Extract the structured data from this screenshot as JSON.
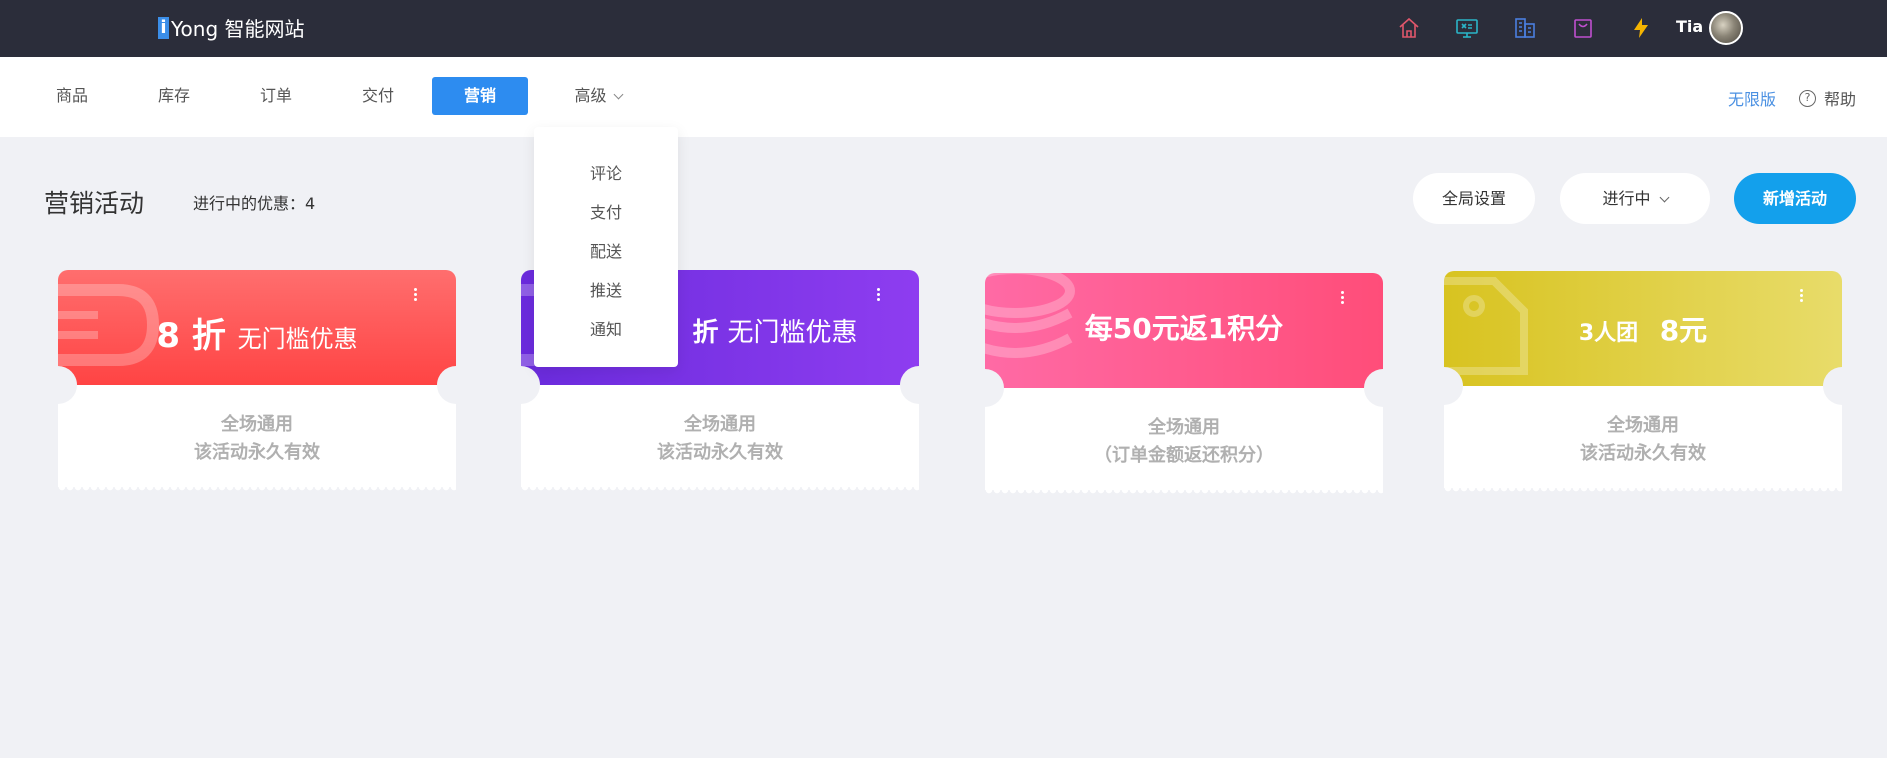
{
  "header": {
    "logo_mark": "i",
    "logo_text": "Yong 智能网站",
    "icons": [
      "home-icon",
      "monitor-icon",
      "building-icon",
      "bag-icon",
      "lightning-icon"
    ],
    "icon_colors": [
      "#e0566b",
      "#2bb5c8",
      "#4a7fe0",
      "#c04fd0",
      "#f5b400"
    ],
    "user_name": "Tia"
  },
  "nav": {
    "items": [
      "商品",
      "库存",
      "订单",
      "交付",
      "营销",
      "高级"
    ],
    "active": "营销",
    "unlimited": "无限版",
    "help": "帮助"
  },
  "dropdown": {
    "items": [
      "评论",
      "支付",
      "配送",
      "推送",
      "通知"
    ]
  },
  "page": {
    "title": "营销活动",
    "active_count_label": "进行中的优惠：4",
    "global_settings": "全局设置",
    "status_filter": "进行中",
    "add_activity": "新增活动"
  },
  "cards": [
    {
      "title_num": "8 折",
      "title_text": "无门槛优惠",
      "line1": "全场通用",
      "line2": "该活动永久有效",
      "color_from": "#ff6e6e",
      "color_to": "#ff4141"
    },
    {
      "title_num": "折",
      "title_text": "无门槛优惠",
      "line1": "全场通用",
      "line2": "该活动永久有效",
      "color_from": "#6a2bdc",
      "color_to": "#8e3df0"
    },
    {
      "title_num": "",
      "title_text": "每50元返1积分",
      "line1": "全场通用",
      "line2": "（订单金额返还积分）",
      "color_from": "#ff6aa5",
      "color_to": "#ff4d79"
    },
    {
      "title_num": "3人团",
      "title_text": "8元",
      "line1": "全场通用",
      "line2": "该活动永久有效",
      "color_from": "#d8c320",
      "color_to": "#e8dc6a"
    }
  ]
}
